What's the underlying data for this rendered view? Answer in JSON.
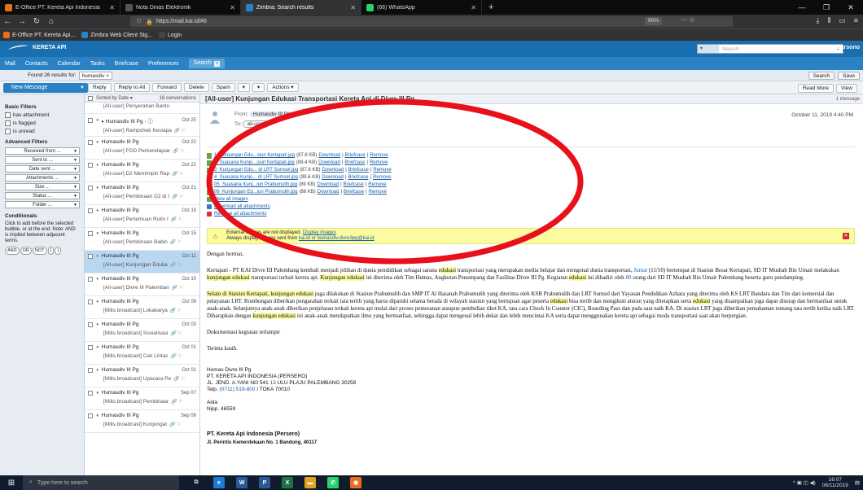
{
  "browser": {
    "tabs": [
      {
        "label": "E-Office PT. Kereta Api Indonesia",
        "color": "#e86d1f",
        "active": false
      },
      {
        "label": "Nota Dinas Elektronik",
        "color": "#555555",
        "active": false
      },
      {
        "label": "Zimbra: Search results",
        "color": "#2a82c4",
        "active": true
      },
      {
        "label": "(66) WhatsApp",
        "color": "#25d366",
        "active": false
      }
    ],
    "url": "https://mail.kai.id/#6",
    "zoom": "90%",
    "bookmarks": [
      {
        "label": "E-Office PT. Kereta Api...",
        "color": "#e86d1f"
      },
      {
        "label": "Zimbra Web Client Sig...",
        "color": "#2a82c4"
      },
      {
        "label": "Login",
        "color": "#444444"
      }
    ]
  },
  "zimbra": {
    "logo": "KERETA API",
    "search_scope": "▾",
    "search_placeholder": "Search",
    "username": "Warsono",
    "app_tabs": [
      "Mail",
      "Contacts",
      "Calendar",
      "Tasks",
      "Briefcase",
      "Preferences"
    ],
    "search_tab": "Search",
    "found_label": "Found 26 results for:",
    "found_query": "humasdiv",
    "search_button": "Search",
    "save_button": "Save"
  },
  "toolbar": {
    "new_message": "New Message",
    "buttons": [
      "Reply",
      "Reply to All",
      "Forward",
      "Delete",
      "Spam",
      "▾",
      "▾",
      "Actions ▾"
    ],
    "read_more": "Read More",
    "view": "View"
  },
  "filters": {
    "basic_title": "Basic Filters",
    "basic": [
      "has attachment",
      "is flagged",
      "is unread"
    ],
    "advanced_title": "Advanced Filters",
    "advanced": [
      "Received from ...",
      "Sent to ...",
      "Date sent ...",
      "Attachments ...",
      "Size ...",
      "Status ...",
      "Folder ..."
    ],
    "conditionals_title": "Conditionals",
    "conditionals_note": "Click to add before the selected bubble, or at the end. Note: AND is implied between adjacent terms.",
    "ops": [
      "AND",
      "OR",
      "NOT",
      "(",
      ")"
    ]
  },
  "list": {
    "sort": "Sorted by Date ▾",
    "count": "18 conversations",
    "first_partial": "[All-user] Penyerahan Bantu",
    "rows": [
      {
        "sender": "▸ Humasdiv III Pg - ⓘ",
        "date": "Oct 25",
        "subject": "[All-user] Rampchek Kesiapa",
        "selected": false
      },
      {
        "sender": "Humasdiv III Pg",
        "date": "Oct 22",
        "subject": "[All-user] FGD Perkeretapiar",
        "selected": false
      },
      {
        "sender": "Humasdiv III Pg",
        "date": "Oct 22",
        "subject": "[All-user] D2 Memimpin Rap",
        "selected": false
      },
      {
        "sender": "Humasdiv III Pg",
        "date": "Oct 21",
        "subject": "[All-user] Pembinaan D2 di I",
        "selected": false
      },
      {
        "sender": "Humasdiv III Pg",
        "date": "Oct 15",
        "subject": "[All-user] Pertemuan Rutin I",
        "selected": false
      },
      {
        "sender": "Humasdiv III Pg",
        "date": "Oct 15",
        "subject": "[All-user] Pembinaan Babin",
        "selected": false
      },
      {
        "sender": "Humasdiv III Pg",
        "date": "Oct 11",
        "subject": "[All-user] Kunjungan Eduka",
        "selected": true
      },
      {
        "sender": "Humasdiv III Pg",
        "date": "Oct 10",
        "subject": "[All-user] Divre III Palemban",
        "selected": false
      },
      {
        "sender": "Humasdiv III Pg",
        "date": "Oct 08",
        "subject": "[Milis.broadcast] Lokakarya",
        "selected": false
      },
      {
        "sender": "Humasdiv III Pg",
        "date": "Oct 03",
        "subject": "[Milis.broadcast] Sosialisasi",
        "selected": false
      },
      {
        "sender": "Humasdiv III Pg",
        "date": "Oct 01",
        "subject": "[Milis.broadcast] Cek Lintas",
        "selected": false
      },
      {
        "sender": "Humasdiv III Pg",
        "date": "Oct 01",
        "subject": "[Milis.broadcast] Upacara Pe",
        "selected": false
      },
      {
        "sender": "Humasdiv III Pg",
        "date": "Sep 07",
        "subject": "[Milis.broadcast] Pembinaar",
        "selected": false
      },
      {
        "sender": "Humasdiv III Pg",
        "date": "Sep 06",
        "subject": "[Milis.broadcast] Kunjungar",
        "selected": false
      }
    ]
  },
  "message": {
    "subject": "[All-user] Kunjungan Edukasi Transportasi Kereta Api di Divre III Pg",
    "count": "1 message",
    "from_label": "From:",
    "from": "Humasdiv III Pg",
    "to_label": "To:",
    "to": "all-user",
    "date": "October 11, 2019 4:40 PM",
    "attachments": [
      {
        "name": "1_Kunjungan Edu...siun Kertapati.jpg",
        "size": "(87.8 KB)"
      },
      {
        "name": "2_Suasana Kunju...siun Kertapati.jpg",
        "size": "(89.4 KB)"
      },
      {
        "name": "3_Kunjungan Edu... di LRT Sumsel.jpg",
        "size": "(87.6 KB)"
      },
      {
        "name": "4_Suasana Kunju... di LRT Sumsel.jpg",
        "size": "(99.6 KB)"
      },
      {
        "name": "05_Suasana Kunj...iun Prabumulih.jpg",
        "size": "(89 KB)"
      },
      {
        "name": "06_Kunjungan Ed...iun Prabumulih.jpg",
        "size": "(86 KB)"
      }
    ],
    "attachment_links": [
      "Download",
      "Briefcase",
      "Remove"
    ],
    "attachment_actions": [
      "View all images",
      "Download all attachments",
      "Remove all attachments"
    ],
    "warning_text": "External images are not displayed.",
    "warning_link": "Display images",
    "warning_text2": "Always display images sent from",
    "warning_sender": "kai.id or humasdiv.divre3pg@kai.id",
    "greeting": "Dengan hormat,",
    "para1": {
      "t1": "Kertapati - PT KAI Divre III Palembang kembali menjadi pilihan di dunia pendidikan sebagai sarana ",
      "h1": "edukasi",
      "t2": " transportasi yang merupakan media belajar dan mengenal dunia transportasi, ",
      "b1": "Jumat",
      "t3": " (11/10) bertempat di Stasiun Besar Kertapati, SD IT Mushab Bin Umair melakukan ",
      "h2": "kunjungan edukasi",
      "t4": " transportasi terkait kereta api. ",
      "h3": "Kunjungan edukasi",
      "t5": " ini diterima oleh Tim Humas, Angkutan Penumpang dan Fasilitas Divre III Pg. Kegiatan ",
      "h4": "edukasi",
      "t6": " ini dihadiri oleh ",
      "b2": "80",
      "t7": " orang  dari SD IT Mushab Bin Umair Palembang beserta guru pendamping."
    },
    "para2": {
      "h1": "Selain di Stasiun Kertapati, kunjungan edukasi",
      "t1": " juga dilakukan di Stasiun Prabumulih dan SMP IT Al Hasanah Prabumulih yang diterima oleh KSB Prabumulih dan LRT Sumsel dari Yayasan Pendidikan Azhara yang diterima oleh KS LRT Bandara dan Tim dari komersial dan pelayanan LRT. Rombongan diberikan pengarahan terkait tata tertib yang harus dipatuhi selama berada di wilayah stasiun yang bertujuan agar peserta ",
      "h2": "edukasi",
      "t2": " bisa tertib dan mengikuti aturan yang ditetapkan serta ",
      "h3": "edukasi",
      "t3": " yang disampaikan juga dapat diserap dan bermanfaat untuk anak-anak. Selanjutnya anak-anak diberikan penjelasan terkait kereta api mulai dari proses pemesanan ataupun pembelian tiket KA, tata cara Check In Counter (CIC), Boarding Pass dan pada saat naik KA. Di stasiun LRT juga diberikan pemahaman tentang tata tertib ketika naik LRT. Diharapkan dengan ",
      "h4": "kunjungan edukasi",
      "t4": " ini anak-anak mendapatkan ilmu yang bermanfaat, sehingga dapat mengenal lebih dekat dan lebih mencintai KA serta dapat menggunakan kereta api sebagai moda transportasi saat akan berpergian."
    },
    "para3": "Dokumentasi kegiatan terlampir",
    "para4": "Terima kasih.",
    "sig": {
      "l1": "Humas Divre III Pg",
      "l2": "PT. KERETA API INDONESIA (PERSERO)",
      "l3a": "JL. JEND. A.YANI NO 541 ",
      "l3b": "13",
      "l3c": " ULU PLAJU PALEMBANG 30258",
      "l4a": "Telp. ",
      "l4b": "(0711) 519-800",
      "l4c": " / TOKA 70010",
      "l5": "Aida",
      "l6": "Nipp. 46559"
    },
    "footer1": "PT. Kereta Api Indonesia (Persero)",
    "footer2": "Jl. Perintis Kemerdekaan No. 1 Bandung, 40117"
  },
  "taskbar": {
    "search_placeholder": "Type here to search",
    "apps": [
      {
        "label": "e",
        "color": "#1e78d6"
      },
      {
        "label": "W",
        "color": "#2b5797"
      },
      {
        "label": "P",
        "color": "#2b5797"
      },
      {
        "label": "X",
        "color": "#1e7145"
      },
      {
        "label": "▬",
        "color": "#e3a21a"
      },
      {
        "label": "✆",
        "color": "#25d366"
      },
      {
        "label": "◉",
        "color": "#e86d1f"
      }
    ],
    "time": "16:07",
    "date": "06/11/2019"
  },
  "annotation_color": "#e8101a"
}
